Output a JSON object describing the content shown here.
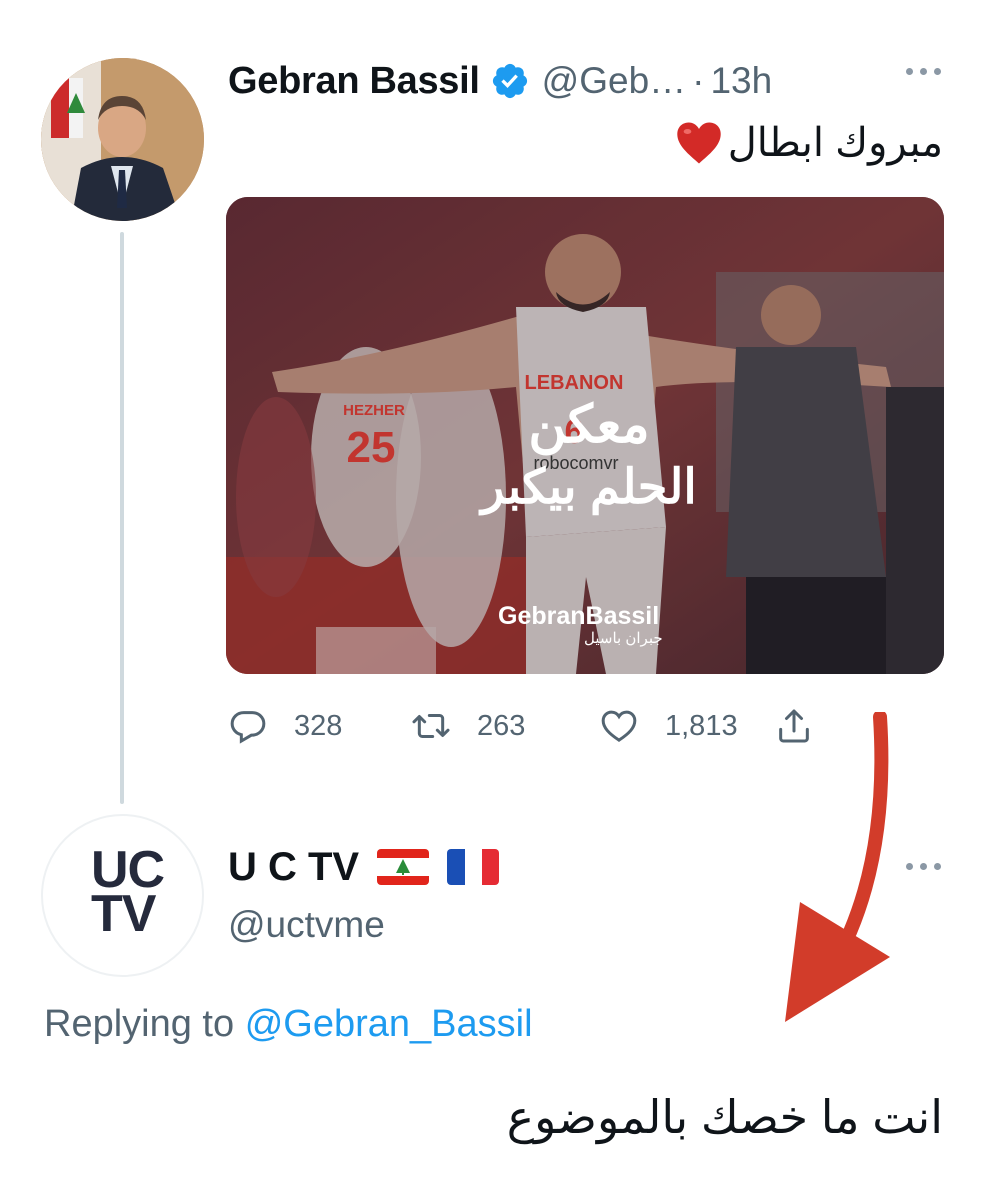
{
  "tweet": {
    "author_name": "Gebran Bassil",
    "handle": "@Geb…",
    "separator": "·",
    "time": "13h",
    "text": "مبروك ابطال",
    "emoji": "heart-emoji",
    "media": {
      "overlay_line1": "معكن",
      "overlay_line2": "الحلم بيكبر",
      "jersey_team": "LEBANON",
      "jersey_number": "6",
      "jersey_sponsor": "robocomvr",
      "jersey_left_name": "HEZHER",
      "jersey_left_number": "25",
      "logo_text": "GebranBassil",
      "logo_text_ar": "جبران باسيل"
    },
    "stats": {
      "replies": "328",
      "retweets": "263",
      "likes": "1,813"
    }
  },
  "reply": {
    "author_name": "U C TV",
    "flags": [
      "lebanon-flag",
      "france-flag"
    ],
    "handle": "@uctvme",
    "avatar_text_top": "UC",
    "avatar_text_bottom": "TV",
    "replying_prefix": "Replying to",
    "replying_mention": "@Gebran_Bassil",
    "text": "انت ما خصك بالموضوع"
  },
  "colors": {
    "verified": "#1d9bf0",
    "link": "#1d9bf0",
    "muted": "#536471",
    "arrow": "#d23c2a",
    "thread_line": "#cfd9de"
  }
}
